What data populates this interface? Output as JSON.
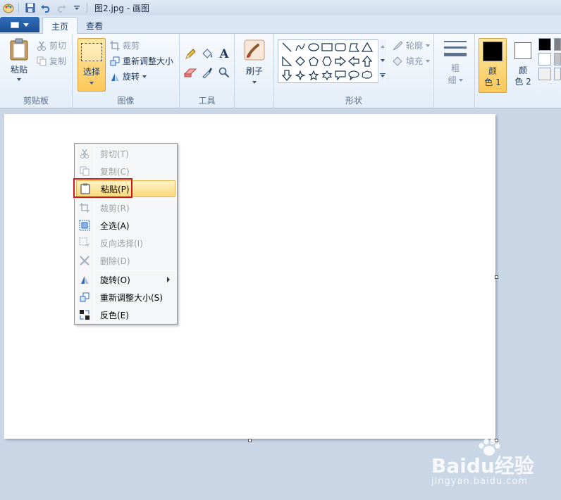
{
  "window": {
    "title": "图2.jpg - 画图"
  },
  "tabs": [
    {
      "label": "主页",
      "active": true
    },
    {
      "label": "查看",
      "active": false
    }
  ],
  "ribbon": {
    "clipboard": {
      "group_label": "剪贴板",
      "paste": "粘贴",
      "cut": "剪切",
      "copy": "复制"
    },
    "image": {
      "group_label": "图像",
      "select": "选择",
      "crop": "裁剪",
      "resize": "重新调整大小",
      "rotate": "旋转"
    },
    "tools": {
      "group_label": "工具",
      "text_glyph": "A"
    },
    "brush": {
      "label": "刷子"
    },
    "shapes": {
      "group_label": "形状",
      "outline": "轮廓",
      "fill": "填充"
    },
    "size": {
      "label_line1": "粗",
      "label_line2": "细"
    },
    "colors": {
      "color1_line1": "颜",
      "color1_line2": "色 1",
      "color2_line1": "颜",
      "color2_line2": "色 2",
      "color1_value": "#000000",
      "color2_value": "#ffffff"
    }
  },
  "context_menu": {
    "items": [
      {
        "label": "剪切(T)",
        "enabled": false,
        "icon": "scissors-icon"
      },
      {
        "label": "复制(C)",
        "enabled": false,
        "icon": "copy-icon"
      },
      {
        "label": "粘贴(P)",
        "enabled": true,
        "icon": "clipboard-icon",
        "highlighted": true
      },
      {
        "label": "裁剪(R)",
        "enabled": false,
        "icon": "crop-icon"
      },
      {
        "label": "全选(A)",
        "enabled": true,
        "icon": "select-all-icon"
      },
      {
        "label": "反向选择(I)",
        "enabled": false,
        "icon": "invert-selection-icon"
      },
      {
        "label": "删除(D)",
        "enabled": false,
        "icon": "delete-icon"
      },
      {
        "label": "旋转(O)",
        "enabled": true,
        "icon": "rotate-icon",
        "submenu": true
      },
      {
        "label": "重新调整大小(S)",
        "enabled": true,
        "icon": "resize-icon"
      },
      {
        "label": "反色(E)",
        "enabled": true,
        "icon": "invert-color-icon"
      }
    ]
  },
  "watermark": {
    "main": "Baidu经验",
    "sub": "jingyan.baidu.com"
  },
  "colors": {
    "accent": "#fbc85a",
    "highlight_box": "#d0191c",
    "canvas_bg": "#c9d6e6"
  }
}
